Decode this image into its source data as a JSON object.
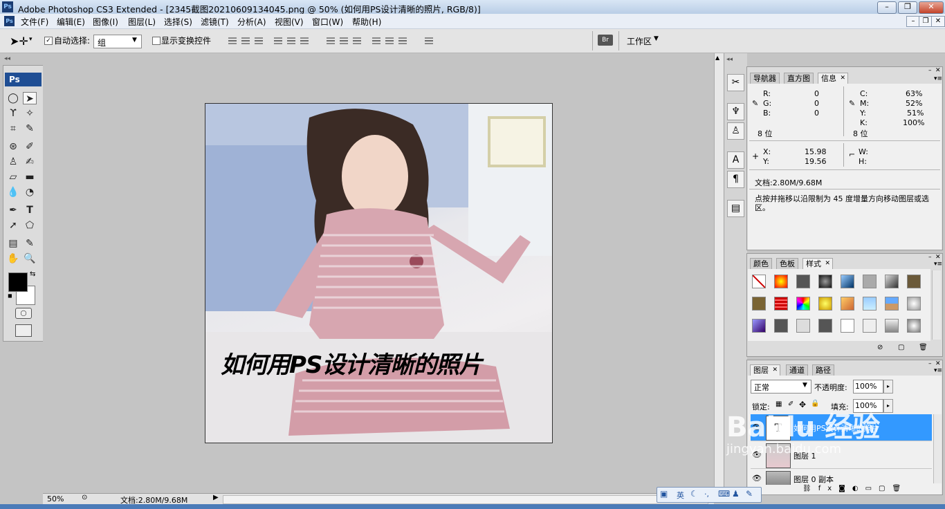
{
  "window": {
    "logo": "Ps",
    "title": "Adobe Photoshop CS3 Extended - [2345截图20210609134045.png @ 50% (如何用PS设计清晰的照片, RGB/8)]"
  },
  "menu": [
    "文件(F)",
    "编辑(E)",
    "图像(I)",
    "图层(L)",
    "选择(S)",
    "滤镜(T)",
    "分析(A)",
    "视图(V)",
    "窗口(W)",
    "帮助(H)"
  ],
  "options": {
    "auto_select_label": "自动选择:",
    "auto_select_value": "组",
    "show_transform_label": "显示变换控件",
    "workspace_label": "工作区"
  },
  "toolbox": {
    "header": "Ps"
  },
  "canvas": {
    "overlay_text": "如何用PS设计清晰的照片"
  },
  "status": {
    "zoom": "50%",
    "doc_size": "文档:2.80M/9.68M"
  },
  "info_panel": {
    "tabs": [
      "导航器",
      "直方图",
      "信息"
    ],
    "rgb": {
      "r_label": "R:",
      "g_label": "G:",
      "b_label": "B:",
      "r": "0",
      "g": "0",
      "b": "0",
      "bits": "8 位"
    },
    "cmyk": {
      "c_label": "C:",
      "m_label": "M:",
      "y_label": "Y:",
      "k_label": "K:",
      "c": "63%",
      "m": "52%",
      "y": "51%",
      "k": "100%",
      "bits": "8 位"
    },
    "xy": {
      "x_label": "X:",
      "y_label": "Y:",
      "x": "15.98",
      "y": "19.56"
    },
    "wh": {
      "w_label": "W:",
      "h_label": "H:"
    },
    "doc": "文档:2.80M/9.68M",
    "hint": "点按并拖移以沿限制为 45 度增量方向移动图层或选区。"
  },
  "styles_panel": {
    "tabs": [
      "颜色",
      "色板",
      "样式"
    ]
  },
  "layers_panel": {
    "tabs": [
      "图层",
      "通道",
      "路径"
    ],
    "blend_mode": "正常",
    "opacity_label": "不透明度:",
    "opacity": "100%",
    "lock_label": "锁定:",
    "fill_label": "填充:",
    "fill": "100%",
    "layers": [
      {
        "name": "如何用PS设计清晰的照片",
        "thumb": "T",
        "selected": true
      },
      {
        "name": "图层 1",
        "thumb": "",
        "selected": false
      },
      {
        "name": "图层 0 副本",
        "thumb": "",
        "selected": false
      }
    ]
  },
  "ime": {
    "lang": "英"
  },
  "watermark": "Baidu 经验",
  "watermark_url": "jingyan.baidu.com"
}
